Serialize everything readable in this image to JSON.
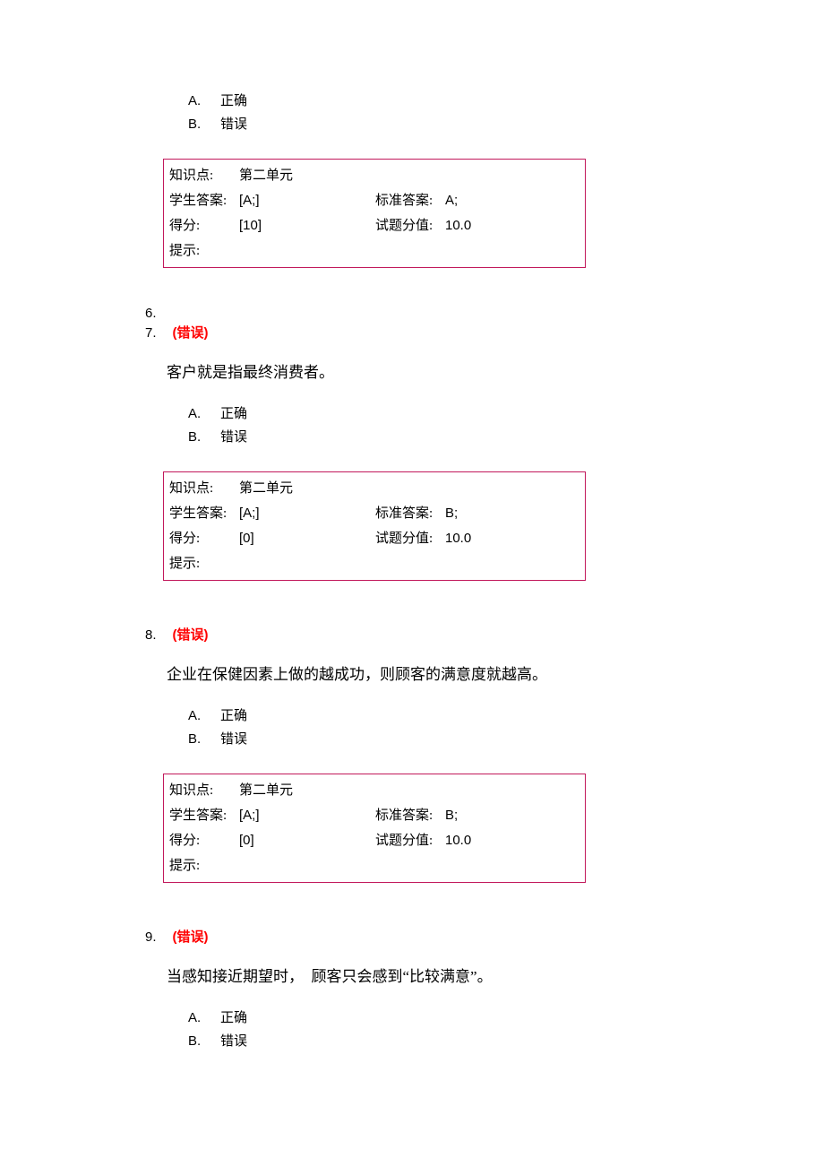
{
  "options_common": {
    "A_letter": "A.",
    "A_text": "正确",
    "B_letter": "B.",
    "B_text": "错误"
  },
  "labels": {
    "knowledge": "知识点:",
    "student_answer": "学生答案:",
    "standard_answer": "标准答案:",
    "score": "得分:",
    "full_score": "试题分值:",
    "hint": "提示:"
  },
  "q5_info": {
    "knowledge": "第二单元",
    "student_answer": "[A;]",
    "standard_answer": "A;",
    "score": "[10]",
    "full_score": "10.0",
    "hint": ""
  },
  "q6": {
    "num": "6."
  },
  "q7": {
    "num": "7.",
    "status": "(错误)",
    "text": "客户就是指最终消费者。",
    "info": {
      "knowledge": "第二单元",
      "student_answer": "[A;]",
      "standard_answer": "B;",
      "score": "[0]",
      "full_score": "10.0",
      "hint": ""
    }
  },
  "q8": {
    "num": "8.",
    "status": "(错误)",
    "text": "企业在保健因素上做的越成功，则顾客的满意度就越高。",
    "info": {
      "knowledge": "第二单元",
      "student_answer": "[A;]",
      "standard_answer": "B;",
      "score": "[0]",
      "full_score": "10.0",
      "hint": ""
    }
  },
  "q9": {
    "num": "9.",
    "status": "(错误)",
    "text": "当感知接近期望时， 顾客只会感到“比较满意”。"
  }
}
